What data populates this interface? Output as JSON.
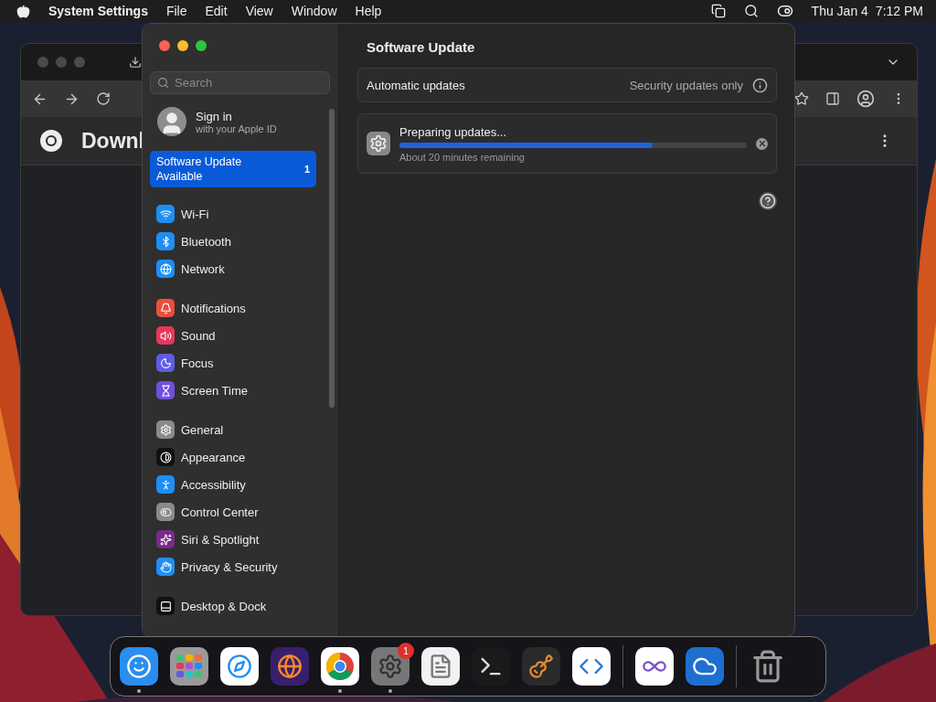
{
  "menu_bar": {
    "app": "System Settings",
    "menus": [
      "File",
      "Edit",
      "View",
      "Window",
      "Help"
    ],
    "date": "Thu Jan 4",
    "time": "7:12 PM"
  },
  "browser": {
    "page_title": "Downl"
  },
  "settings": {
    "title": "Software Update",
    "search": {
      "placeholder": "Search"
    },
    "account": {
      "name": "Sign in",
      "subtitle": "with your Apple ID"
    },
    "update_item": {
      "label": "Software Update Available",
      "badge": "1",
      "selected": true
    },
    "sidebar_groups": [
      [
        {
          "label": "Wi-Fi",
          "kind": "wifi",
          "selected": false
        },
        {
          "label": "Bluetooth",
          "kind": "bluetooth",
          "selected": false
        },
        {
          "label": "Network",
          "kind": "network",
          "selected": false
        }
      ],
      [
        {
          "label": "Notifications",
          "kind": "notifications",
          "selected": false
        },
        {
          "label": "Sound",
          "kind": "sound",
          "selected": false
        },
        {
          "label": "Focus",
          "kind": "focus",
          "selected": false
        },
        {
          "label": "Screen Time",
          "kind": "screentime",
          "selected": false
        }
      ],
      [
        {
          "label": "General",
          "kind": "general",
          "selected": false
        },
        {
          "label": "Appearance",
          "kind": "appearance",
          "selected": false
        },
        {
          "label": "Accessibility",
          "kind": "accessibility",
          "selected": false
        },
        {
          "label": "Control Center",
          "kind": "controlcenter",
          "selected": false
        },
        {
          "label": "Siri & Spotlight",
          "kind": "siri",
          "selected": false
        },
        {
          "label": "Privacy & Security",
          "kind": "privacy",
          "selected": false
        }
      ],
      [
        {
          "label": "Desktop & Dock",
          "kind": "desktop",
          "selected": false
        }
      ]
    ],
    "automatic_updates": {
      "label": "Automatic updates",
      "value": "Security updates only"
    },
    "progress": {
      "title": "Preparing updates...",
      "level": 0.73,
      "subtitle": "About 20 minutes remaining"
    }
  },
  "dock": {
    "apps": [
      {
        "kind": "finder",
        "running": true
      },
      {
        "kind": "launchpad",
        "running": false
      },
      {
        "kind": "safari",
        "running": false
      },
      {
        "kind": "firefox",
        "running": false
      },
      {
        "kind": "chrome",
        "running": true
      },
      {
        "kind": "settings",
        "running": true,
        "badge": "1"
      },
      {
        "kind": "textedit",
        "running": false
      },
      {
        "kind": "terminal",
        "running": false
      },
      {
        "kind": "garageband",
        "running": false
      },
      {
        "kind": "vscode",
        "running": false
      },
      {
        "kind": "divider"
      },
      {
        "kind": "visualstudio",
        "running": false
      },
      {
        "kind": "weather",
        "running": false
      },
      {
        "kind": "divider"
      },
      {
        "kind": "trash",
        "running": false
      }
    ]
  }
}
